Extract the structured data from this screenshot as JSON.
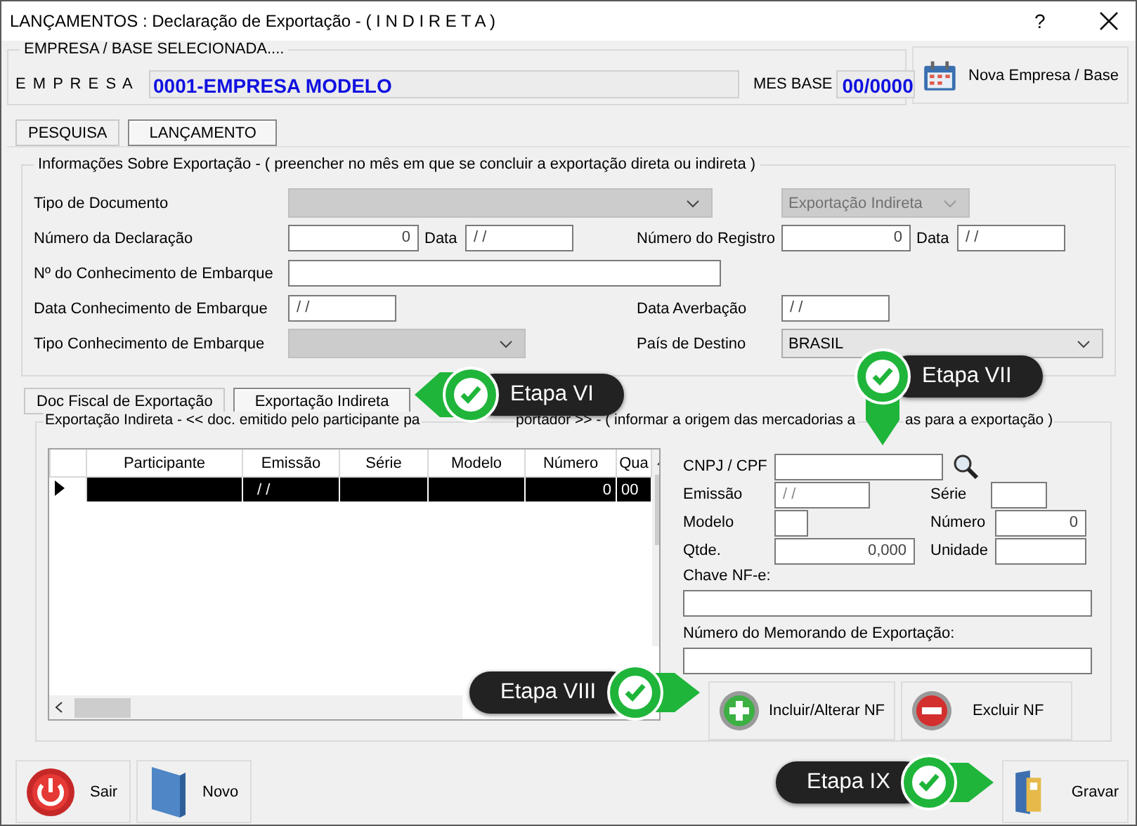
{
  "window": {
    "title": "LANÇAMENTOS : Declaração de Exportação - ( I N D I R E T A )",
    "help": "?"
  },
  "company": {
    "legend": "EMPRESA  /  BASE  SELECIONADA....",
    "label": "E M P R E S A",
    "value": "0001-EMPRESA MODELO",
    "base_label": "MES BASE",
    "base_value": "00/0000"
  },
  "change_company_button": "Nova Empresa / Base",
  "tabs": [
    {
      "label": "PESQUISA",
      "selected": false
    },
    {
      "label": "LANÇAMENTO",
      "selected": true
    }
  ],
  "export_info": {
    "legend": "Informações Sobre Exportação - ( preencher no mês em que se concluir a exportação direta ou indireta )",
    "document_type_label": "Tipo de Documento",
    "document_type": {
      "disabled": true
    },
    "export_kind": {
      "value": "Exportação Indireta",
      "disabled": true
    },
    "declaration_number_label": "Número da Declaração",
    "declaration_number": "0",
    "declaration_date_label": "Data",
    "declaration_date": "/ /",
    "registry_number_label": "Número do Registro",
    "registry_number": "0",
    "registry_date_label": "Data",
    "registry_date": "/ /",
    "bill_number_label": "Nº do Conhecimento de Embarque",
    "bill_date_label": "Data Conhecimento de Embarque",
    "bill_date": "/ /",
    "endorsement_date_label": "Data Averbação",
    "endorsement_date": "/ /",
    "bill_type_label": "Tipo Conhecimento de Embarque",
    "bill_type": {
      "disabled": true
    },
    "country_label": "País de Destino",
    "country": {
      "value": "BRASIL",
      "disabled": false
    }
  },
  "subtabs": [
    {
      "label": "Doc Fiscal de Exportação",
      "selected": false
    },
    {
      "label": "Exportação Indireta",
      "selected": true
    }
  ],
  "indirect": {
    "legend_parts": [
      "Exportação Indireta - << doc. emitido pelo participante pa",
      "portador >>  - (  informar a origem das mercadorias a",
      "as para a exportação )"
    ],
    "grid": {
      "columns": [
        "Participante",
        "Emissão",
        "Série",
        "Modelo",
        "Número",
        "Qua"
      ],
      "rows": [
        {
          "issue": "/ /",
          "number": "0",
          "column_6": "00",
          "selected": true
        }
      ]
    },
    "form": {
      "cnpj_label": "CNPJ / CPF",
      "issue_label": "Emissão",
      "issue": "/ /",
      "series_label": "Série",
      "model_label": "Modelo",
      "number_label": "Número",
      "number": "0",
      "quantity_label": "Qtde.",
      "quantity": "0,000",
      "unit_label": "Unidade",
      "key_label": "Chave NF-e:",
      "memo_label": "Número do Memorando de Exportação:"
    },
    "add_button": "Incluir/Alterar NF",
    "delete_button": "Excluir NF"
  },
  "footer": {
    "exit_button": "Sair",
    "new_button": "Novo",
    "save_button": "Gravar"
  },
  "callouts": [
    {
      "label": "Etapa VI",
      "kind": "left"
    },
    {
      "label": "Etapa VII",
      "kind": "down"
    },
    {
      "label": "Etapa VIII",
      "kind": "right"
    },
    {
      "label": "Etapa IX",
      "kind": "right"
    }
  ]
}
